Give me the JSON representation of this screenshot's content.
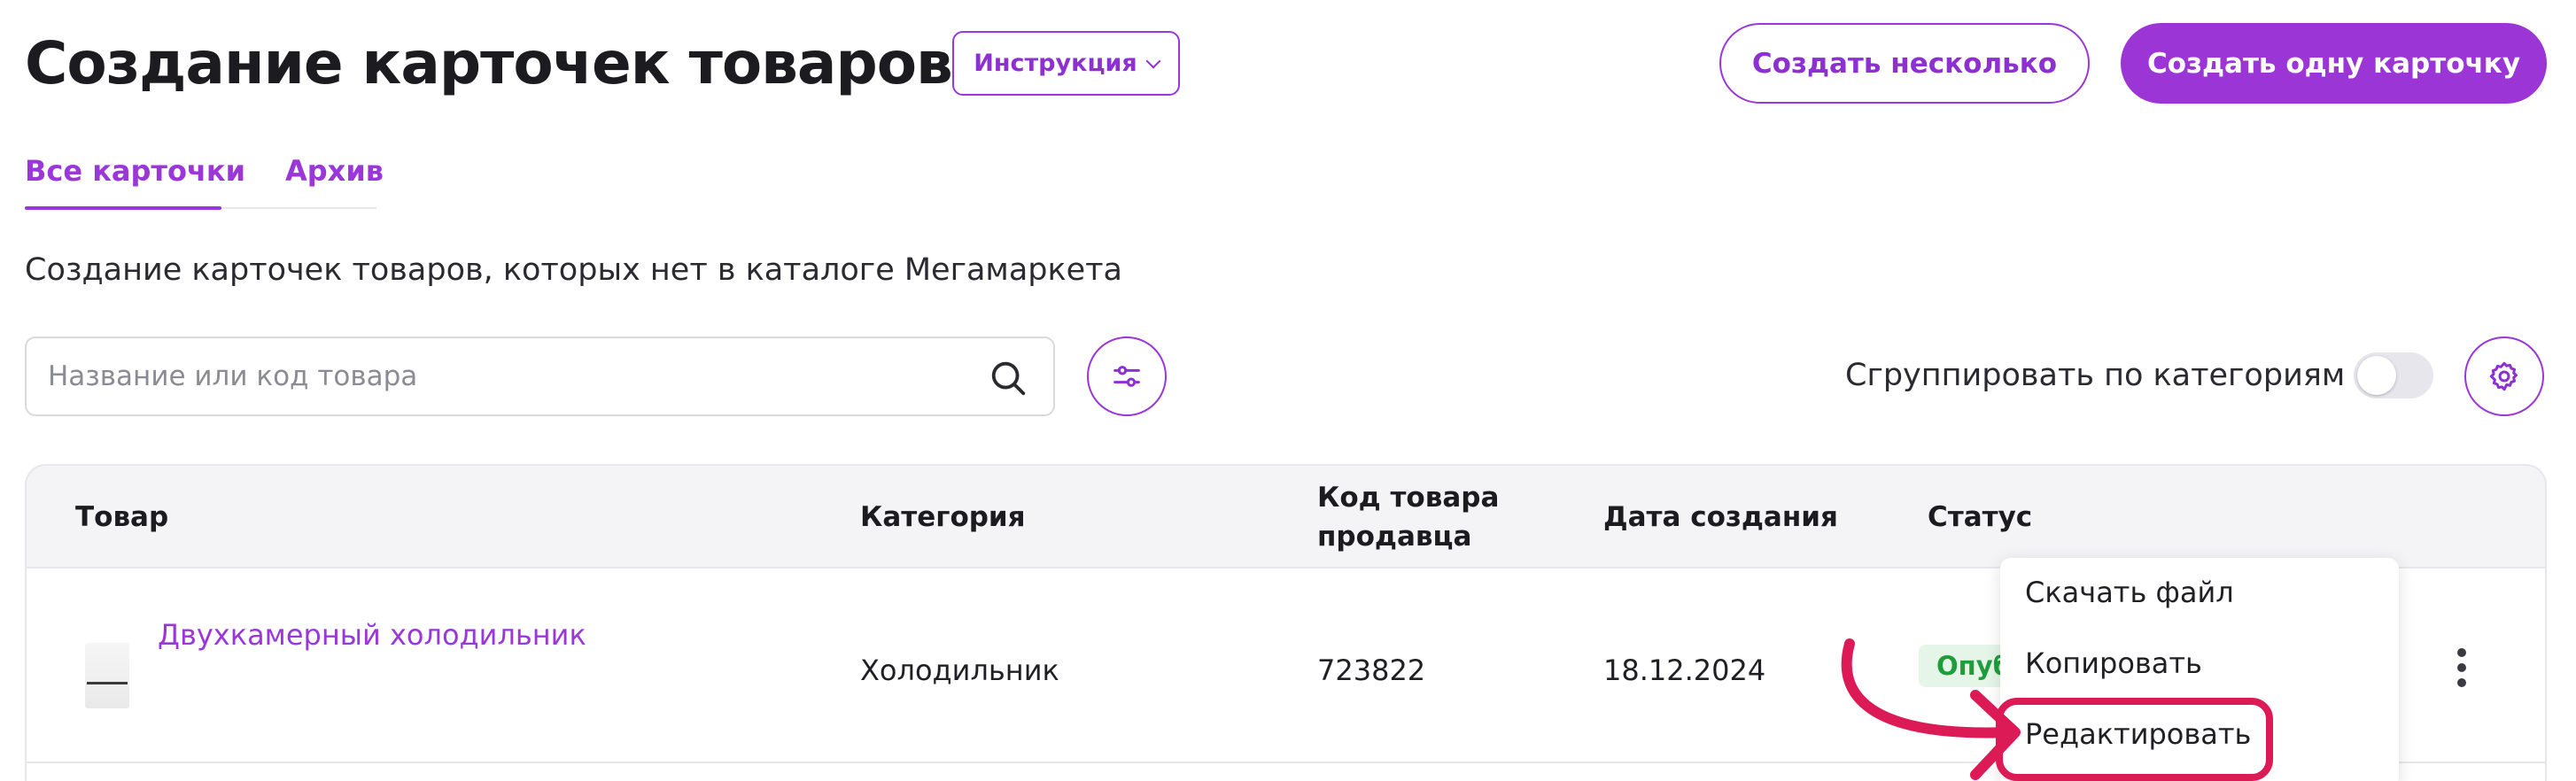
{
  "header": {
    "title": "Создание карточек товаров",
    "instruction_button": "Инструкция",
    "create_multiple_button": "Создать несколько",
    "create_one_button": "Создать одну карточку"
  },
  "tabs": [
    {
      "label": "Все карточки",
      "active": true
    },
    {
      "label": "Архив",
      "active": false
    }
  ],
  "subtitle": "Создание карточек товаров, которых нет в каталоге Мегамаркета",
  "search": {
    "placeholder": "Название или код товара",
    "value": ""
  },
  "group_toggle": {
    "label": "Сгруппировать по категориям",
    "on": false
  },
  "table": {
    "columns": [
      "Товар",
      "Категория",
      "Код товара продавца",
      "Дата создания",
      "Статус"
    ],
    "column_lines": {
      "code": [
        "Код товара",
        "продавца"
      ]
    },
    "rows": [
      {
        "product": "Двухкамерный холодильник",
        "category": "Холодильник",
        "code": "723822",
        "date": "18.12.2024",
        "status": "Опубликовано"
      }
    ]
  },
  "row_menu": {
    "items": [
      "Скачать файл",
      "Копировать",
      "Редактировать"
    ],
    "highlighted": "Редактировать"
  },
  "colors": {
    "accent": "#9b35d6",
    "annotation": "#dc1a56",
    "status_green": "#1f9d3d"
  },
  "icons": [
    "chevron-down-icon",
    "search-icon",
    "filter-sliders-icon",
    "gear-icon",
    "more-vertical-icon",
    "arrow-annotation"
  ]
}
